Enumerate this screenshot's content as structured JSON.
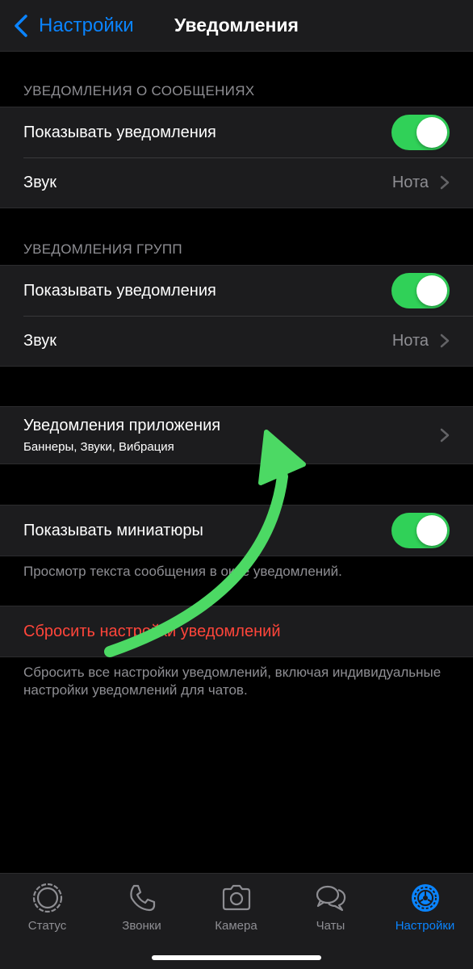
{
  "navbar": {
    "back_label": "Настройки",
    "title": "Уведомления"
  },
  "message_notifications": {
    "header": "УВЕДОМЛЕНИЯ О СООБЩЕНИЯХ",
    "show_label": "Показывать уведомления",
    "show_enabled": true,
    "sound_label": "Звук",
    "sound_value": "Нота"
  },
  "group_notifications": {
    "header": "УВЕДОМЛЕНИЯ ГРУПП",
    "show_label": "Показывать уведомления",
    "show_enabled": true,
    "sound_label": "Звук",
    "sound_value": "Нота"
  },
  "app_notifications": {
    "label": "Уведомления приложения",
    "subtitle": "Баннеры, Звуки, Вибрация"
  },
  "previews": {
    "label": "Показывать миниатюры",
    "enabled": true,
    "footer": "Просмотр текста сообщения в окне уведомлений."
  },
  "reset": {
    "label": "Сбросить настройки уведомлений",
    "footer": "Сбросить все настройки уведомлений, включая индивидуальные настройки уведомлений для чатов."
  },
  "tabbar": {
    "tabs": [
      {
        "label": "Статус",
        "icon": "status-icon",
        "active": false
      },
      {
        "label": "Звонки",
        "icon": "phone-icon",
        "active": false
      },
      {
        "label": "Камера",
        "icon": "camera-icon",
        "active": false
      },
      {
        "label": "Чаты",
        "icon": "chats-icon",
        "active": false
      },
      {
        "label": "Настройки",
        "icon": "settings-gear-icon",
        "active": true
      }
    ]
  },
  "colors": {
    "accent": "#0a84ff",
    "toggle_on": "#30d158",
    "destructive": "#ff453a",
    "annotation_arrow": "#4cd964"
  }
}
